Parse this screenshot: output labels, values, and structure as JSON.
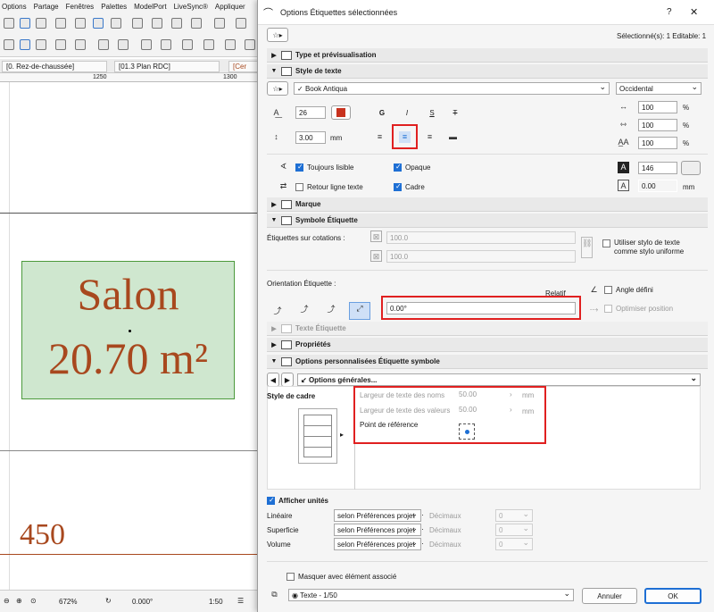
{
  "app": {
    "menu": [
      "Options",
      "Partage",
      "Fenêtres",
      "Palettes",
      "ModelPort",
      "LiveSync®",
      "Appliquer"
    ],
    "tabs": [
      "[0. Rez-de-chaussée]",
      "[01.3 Plan RDC]",
      "[Cer"
    ],
    "ruler": [
      "1250",
      "1300"
    ],
    "label_line1": "Salon",
    "label_line2": "20.70 m²",
    "dimension_text": "450",
    "status": {
      "zoom": "672%",
      "angle": "0.000°",
      "scale": "1:50"
    }
  },
  "dialog": {
    "title": "Options Étiquettes sélectionnées",
    "help": "?",
    "close": "✕",
    "selection_info": "Sélectionné(s): 1 Editable: 1",
    "sections": {
      "type_preview": "Type et prévisualisation",
      "text_style": "Style de texte",
      "marker": "Marque",
      "symbol_label": "Symbole Étiquette",
      "label_text": "Texte Étiquette",
      "properties": "Propriétés",
      "custom_options": "Options personnalisées Étiquette symbole"
    },
    "font": {
      "name": "Book Antiqua",
      "script": "Occidental"
    },
    "size": {
      "value": "26",
      "spacing": "3.00",
      "spacing_unit": "mm"
    },
    "format_buttons": [
      "G",
      "I",
      "S",
      "T"
    ],
    "scales": [
      {
        "value": "100",
        "unit": "%"
      },
      {
        "value": "100",
        "unit": "%"
      },
      {
        "value": "100",
        "unit": "%"
      }
    ],
    "options": {
      "always_readable": "Toujours lisible",
      "wrap_text": "Retour ligne texte",
      "opaque": "Opaque",
      "frame": "Cadre",
      "pen_value": "146",
      "frame_offset": "0.00",
      "frame_offset_unit": "mm"
    },
    "dimension_labels": {
      "label": "Étiquettes sur cotations :",
      "v1": "100.0",
      "v2": "100.0",
      "uniform_pen": "Utiliser stylo de texte comme stylo uniforme"
    },
    "orientation": {
      "label": "Orientation Étiquette :",
      "relative": "Relatif",
      "angle_value": "0.00°",
      "fixed_angle": "Angle défini",
      "optimize": "Optimiser position"
    },
    "custom": {
      "page": "Options générales...",
      "frame_style": "Style de cadre",
      "name_width_label": "Largeur de texte des noms",
      "name_width": "50.00",
      "value_width_label": "Largeur de texte des valeurs",
      "value_width": "50.00",
      "unit": "mm",
      "ref_point": "Point de référence",
      "show_units": "Afficher unités",
      "rows": [
        {
          "label": "Linéaire",
          "value": "selon Préférences projet",
          "dec_label": "Décimaux",
          "dec": "0"
        },
        {
          "label": "Superficie",
          "value": "selon Préférences projet",
          "dec_label": "Décimaux",
          "dec": "0"
        },
        {
          "label": "Volume",
          "value": "selon Préférences projet",
          "dec_label": "Décimaux",
          "dec": "0"
        }
      ]
    },
    "hide_with_element": "Masquer avec élément associé",
    "layer": "Texte - 1/50",
    "cancel": "Annuler",
    "ok": "OK"
  },
  "colors": {
    "accent": "#1e6fd4",
    "highlight": "#e02020",
    "label_text": "#a8481e",
    "label_fill": "#cfe7cf"
  }
}
